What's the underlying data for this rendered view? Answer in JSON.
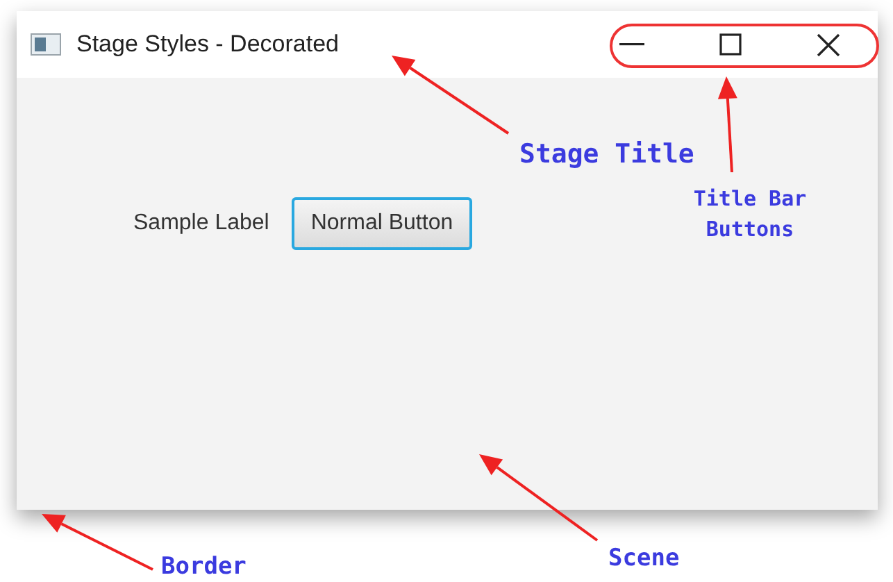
{
  "window": {
    "title": "Stage Styles - Decorated",
    "title_bar_buttons": [
      {
        "kind": "minimize"
      },
      {
        "kind": "maximize"
      },
      {
        "kind": "close"
      }
    ]
  },
  "scene": {
    "label": "Sample Label",
    "button": {
      "label": "Normal Button",
      "focused": true
    }
  },
  "annotations": [
    {
      "text": "Stage Title"
    },
    {
      "text": "Title Bar Buttons"
    },
    {
      "text": "Border"
    },
    {
      "text": "Scene"
    }
  ]
}
